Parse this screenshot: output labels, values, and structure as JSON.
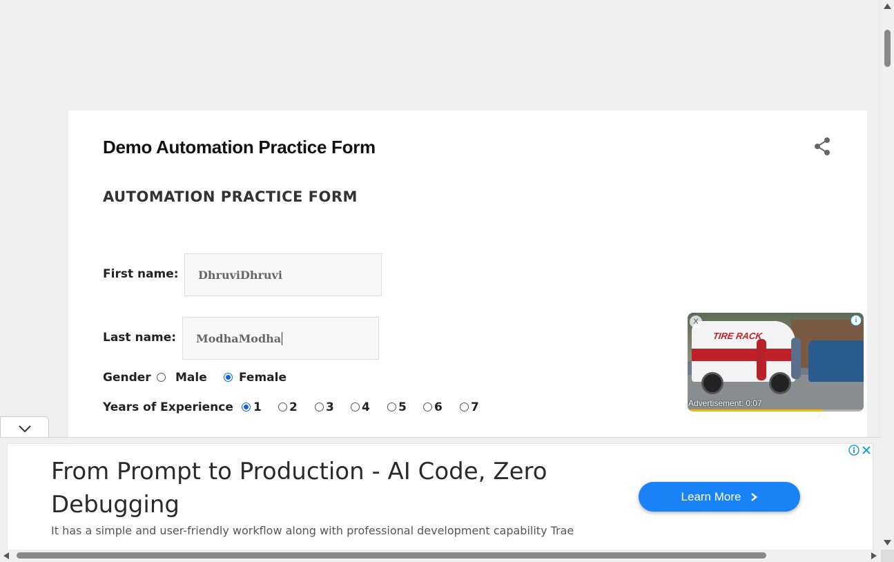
{
  "post": {
    "title": "Demo Automation Practice Form"
  },
  "form": {
    "heading": "AUTOMATION PRACTICE FORM",
    "first_name_label": "First name:",
    "first_name_value": "DhruviDhruvi",
    "last_name_label": "Last name:",
    "last_name_value": "ModhaModha",
    "gender_label": "Gender",
    "gender_options": [
      "Male",
      "Female"
    ],
    "gender_selected": "Female",
    "experience_label": "Years of Experience",
    "experience_options": [
      "1",
      "2",
      "3",
      "4",
      "5",
      "6",
      "7"
    ],
    "experience_selected": "1"
  },
  "video_ad": {
    "close_label": "X",
    "info_label": "i",
    "brand_text": "TIRE RACK",
    "status_text": "Advertisement: 0:07",
    "progress": 0.77
  },
  "banner_ad": {
    "headline": "From Prompt to Production - AI Code, Zero Debugging",
    "description": "It has a simple and user-friendly workflow along with professional development capability Trae",
    "cta_label": "Learn More",
    "cta_color": "#1a82f7"
  },
  "icons": {
    "share": "share-icon",
    "collapse": "chevron-down-icon",
    "cta_arrow": "chevron-right-icon",
    "ad_info": "info-icon",
    "ad_close": "close-icon"
  },
  "colors": {
    "page_bg": "#eeeeee",
    "radio_selected": "#0b63d6",
    "ad_choices": "#1a9fd8"
  }
}
